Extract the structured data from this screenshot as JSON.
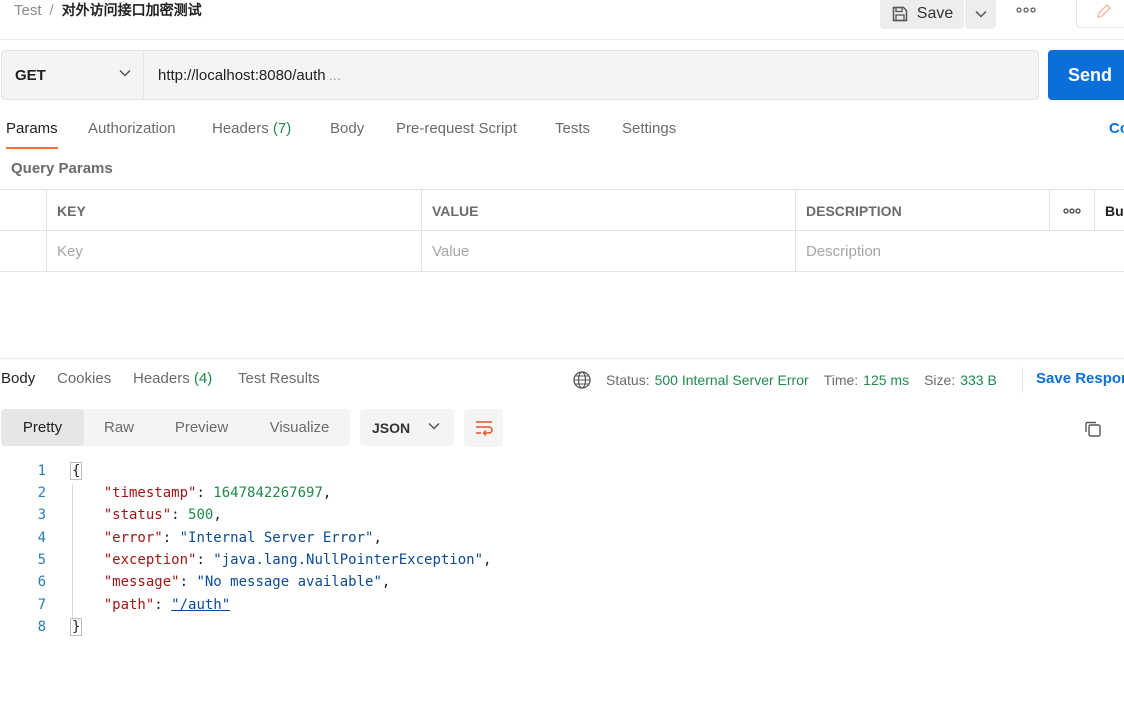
{
  "header": {
    "breadcrumb_parent": "Test",
    "breadcrumb_sep": "/",
    "breadcrumb_current": "对外访问接口加密测试",
    "save_label": "Save"
  },
  "request": {
    "method": "GET",
    "url": "http://localhost:8080/auth",
    "url_ellipsis": "...",
    "send_label": "Send"
  },
  "request_tabs": [
    {
      "label": "Params",
      "count": ""
    },
    {
      "label": "Authorization",
      "count": ""
    },
    {
      "label": "Headers",
      "count": "(7)"
    },
    {
      "label": "Body",
      "count": ""
    },
    {
      "label": "Pre-request Script",
      "count": ""
    },
    {
      "label": "Tests",
      "count": ""
    },
    {
      "label": "Settings",
      "count": ""
    }
  ],
  "cookies_label": "Co",
  "query_params": {
    "title": "Query Params",
    "headers": {
      "key": "KEY",
      "value": "VALUE",
      "description": "DESCRIPTION",
      "bulk": "Bu"
    },
    "placeholders": {
      "key": "Key",
      "value": "Value",
      "description": "Description"
    }
  },
  "response_tabs": [
    {
      "label": "Body",
      "count": ""
    },
    {
      "label": "Cookies",
      "count": ""
    },
    {
      "label": "Headers",
      "count": "(4)"
    },
    {
      "label": "Test Results",
      "count": ""
    }
  ],
  "response_meta": {
    "status_label": "Status:",
    "status_value": "500 Internal Server Error",
    "time_label": "Time:",
    "time_value": "125 ms",
    "size_label": "Size:",
    "size_value": "333 B",
    "save_response": "Save Respor"
  },
  "view_modes": [
    "Pretty",
    "Raw",
    "Preview",
    "Visualize"
  ],
  "format": "JSON",
  "code_lines": [
    {
      "n": "1",
      "text": "{"
    },
    {
      "n": "2",
      "key": "\"timestamp\"",
      "value": "1647842267697",
      "type": "number",
      "comma": true
    },
    {
      "n": "3",
      "key": "\"status\"",
      "value": "500",
      "type": "number",
      "comma": true
    },
    {
      "n": "4",
      "key": "\"error\"",
      "value": "\"Internal Server Error\"",
      "type": "string",
      "comma": true
    },
    {
      "n": "5",
      "key": "\"exception\"",
      "value": "\"java.lang.NullPointerException\"",
      "type": "string",
      "comma": true
    },
    {
      "n": "6",
      "key": "\"message\"",
      "value": "\"No message available\"",
      "type": "string",
      "comma": true
    },
    {
      "n": "7",
      "key": "\"path\"",
      "value": "\"/auth\"",
      "type": "link",
      "comma": false
    },
    {
      "n": "8",
      "text": "}"
    }
  ],
  "colors": {
    "accent_send": "#0b6fdb",
    "active_tab_underline": "#ff6c37",
    "status_green": "#1f8a4c"
  }
}
